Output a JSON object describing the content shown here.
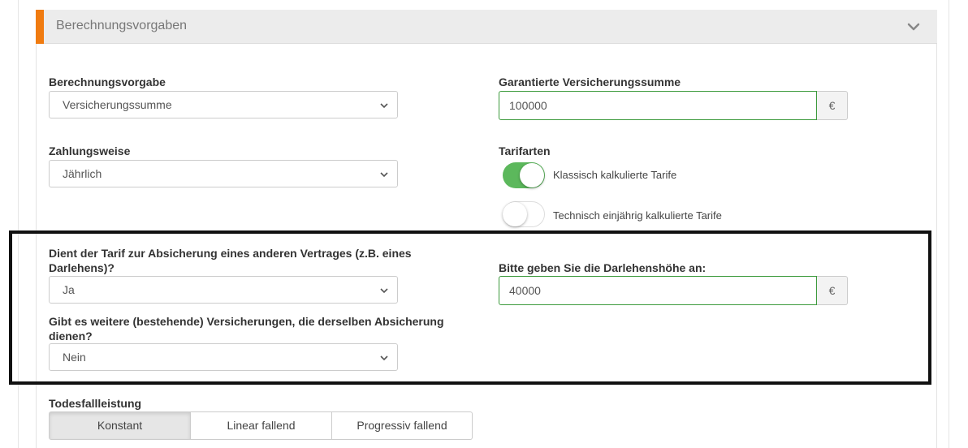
{
  "panel": {
    "title": "Berechnungsvorgaben",
    "collapse_icon": "chevron-down-icon",
    "accent_color": "#f07b10"
  },
  "left": {
    "berechnungsvorgabe": {
      "label": "Berechnungsvorgabe",
      "value": "Versicherungssumme"
    },
    "zahlungsweise": {
      "label": "Zahlungsweise",
      "value": "Jährlich"
    },
    "absicherung": {
      "label": "Dient der Tarif zur Absicherung eines anderen Vertrages (z.B. eines Darlehens)?",
      "value": "Ja"
    },
    "weitere": {
      "label": "Gibt es weitere (bestehende) Versicherungen, die derselben Absicherung dienen?",
      "value": "Nein"
    }
  },
  "right": {
    "versicherungssumme": {
      "label": "Garantierte Versicherungssumme",
      "value": "100000",
      "unit": "€"
    },
    "tarifarten": {
      "label": "Tarifarten",
      "options": [
        {
          "label": "Klassisch kalkulierte Tarife",
          "enabled": true
        },
        {
          "label": "Technisch einjährig kalkulierte Tarife",
          "enabled": false
        }
      ]
    },
    "darlehen": {
      "label": "Bitte geben Sie die Darlehenshöhe an:",
      "value": "40000",
      "unit": "€"
    }
  },
  "todesfall": {
    "label": "Todesfallleistung",
    "options": [
      "Konstant",
      "Linear fallend",
      "Progressiv fallend"
    ],
    "selected": "Konstant"
  },
  "colors": {
    "toggle_on": "#5cb85c",
    "input_border_valid": "#3c9a3c",
    "highlight_border": "#111111"
  }
}
